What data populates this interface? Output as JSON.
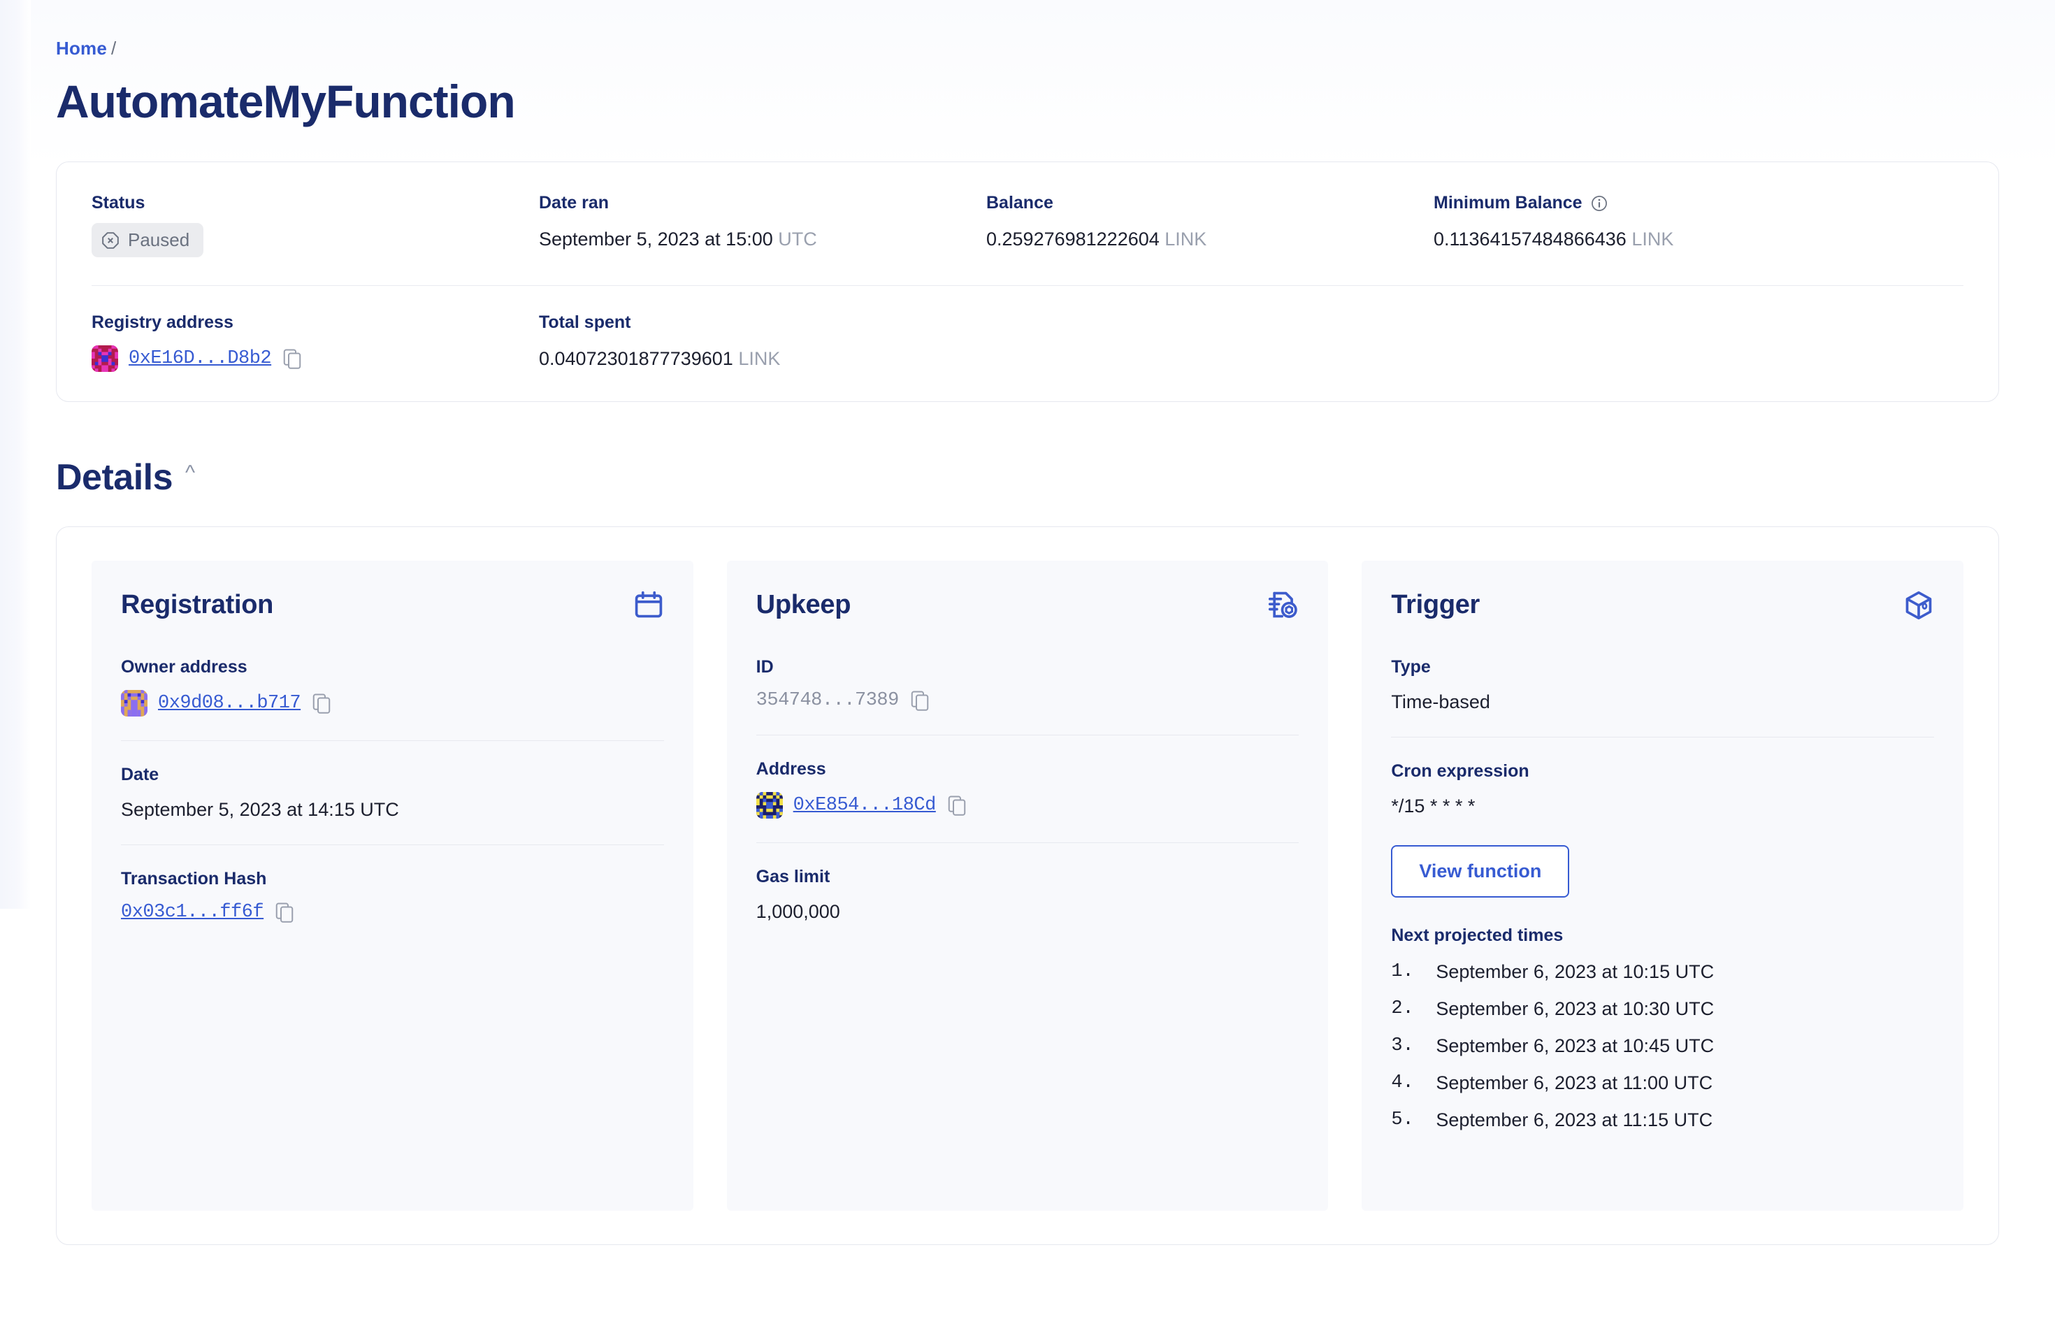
{
  "breadcrumb": {
    "home": "Home",
    "separator": "/"
  },
  "page_title": "AutomateMyFunction",
  "summary": {
    "status": {
      "label": "Status",
      "value": "Paused"
    },
    "date_ran": {
      "label": "Date ran",
      "value": "September 5, 2023 at 15:00",
      "suffix": "UTC"
    },
    "balance": {
      "label": "Balance",
      "value": "0.259276981222604",
      "unit": "LINK"
    },
    "minimum_balance": {
      "label": "Minimum Balance",
      "value": "0.11364157484866436",
      "unit": "LINK"
    },
    "registry_address": {
      "label": "Registry address",
      "value": "0xE16D...D8b2"
    },
    "total_spent": {
      "label": "Total spent",
      "value": "0.04072301877739601",
      "unit": "LINK"
    }
  },
  "details": {
    "heading": "Details",
    "registration": {
      "title": "Registration",
      "owner_address": {
        "label": "Owner address",
        "value": "0x9d08...b717"
      },
      "date": {
        "label": "Date",
        "value": "September 5, 2023 at 14:15 UTC"
      },
      "transaction_hash": {
        "label": "Transaction Hash",
        "value": "0x03c1...ff6f"
      }
    },
    "upkeep": {
      "title": "Upkeep",
      "id": {
        "label": "ID",
        "value": "354748...7389"
      },
      "address": {
        "label": "Address",
        "value": "0xE854...18Cd"
      },
      "gas_limit": {
        "label": "Gas limit",
        "value": "1,000,000"
      }
    },
    "trigger": {
      "title": "Trigger",
      "type": {
        "label": "Type",
        "value": "Time-based"
      },
      "cron_expression": {
        "label": "Cron expression",
        "value": "*/15 * * * *"
      },
      "view_function_label": "View function",
      "next_projected_times": {
        "label": "Next projected times",
        "items": [
          {
            "num": "1.",
            "time": "September 6, 2023 at 10:15 UTC"
          },
          {
            "num": "2.",
            "time": "September 6, 2023 at 10:30 UTC"
          },
          {
            "num": "3.",
            "time": "September 6, 2023 at 10:45 UTC"
          },
          {
            "num": "4.",
            "time": "September 6, 2023 at 11:00 UTC"
          },
          {
            "num": "5.",
            "time": "September 6, 2023 at 11:15 UTC"
          }
        ]
      }
    }
  },
  "colors": {
    "brand_blue": "#375bd2",
    "title_navy": "#1a2b6b",
    "muted": "#9aa0ae",
    "badge_bg": "#ebecef"
  },
  "icons": {
    "registration": "calendar-icon",
    "upkeep": "document-seal-icon",
    "trigger": "cube-icon",
    "copy": "copy-icon",
    "info": "info-icon",
    "status": "octagon-x-icon",
    "collapse": "chevron-up-icon"
  }
}
